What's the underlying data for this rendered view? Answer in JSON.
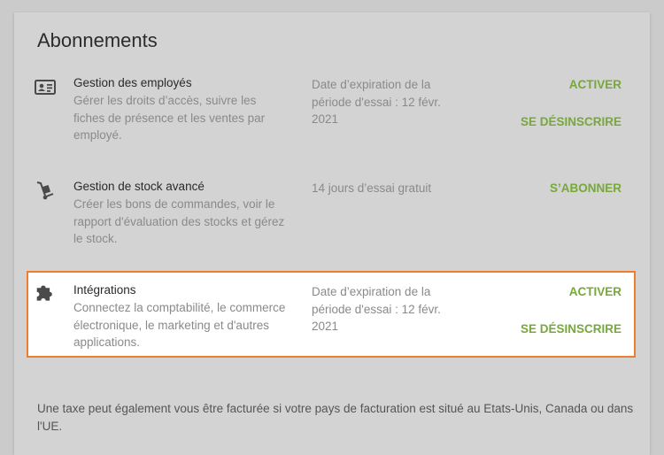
{
  "header": {
    "title": "Abonnements"
  },
  "subscriptions": [
    {
      "icon": "id-card-icon",
      "name": "Gestion des employés",
      "description": "Gérer les droits d’accès, suivre les fiches de présence et les ventes par employé.",
      "trial": "Date d’expiration de la période d'essai : 12 févr. 2021",
      "actions": [
        "ACTIVER",
        "SE DÉSINSCRIRE"
      ]
    },
    {
      "icon": "hand-truck-icon",
      "name": "Gestion de stock avancé",
      "description": "Créer les bons de commandes, voir le rapport d'évaluation des stocks et gérez le stock.",
      "trial": "14 jours d’essai gratuit",
      "actions": [
        "S’ABONNER"
      ]
    },
    {
      "icon": "puzzle-piece-icon",
      "name": "Intégrations",
      "description": "Connectez la comptabilité, le commerce électronique, le marketing et d'autres applications.",
      "trial": "Date d’expiration de la période d'essai : 12 févr. 2021",
      "actions": [
        "ACTIVER",
        "SE DÉSINSCRIRE"
      ],
      "highlighted": true
    }
  ],
  "footer_note": "Une taxe peut également vous être facturée si votre pays de facturation est situé au Etats-Unis, Canada ou dans l'UE.",
  "colors": {
    "accent": "#76a83a",
    "highlight_border": "#ee7d2e",
    "overlay": "#cbcbcb"
  }
}
